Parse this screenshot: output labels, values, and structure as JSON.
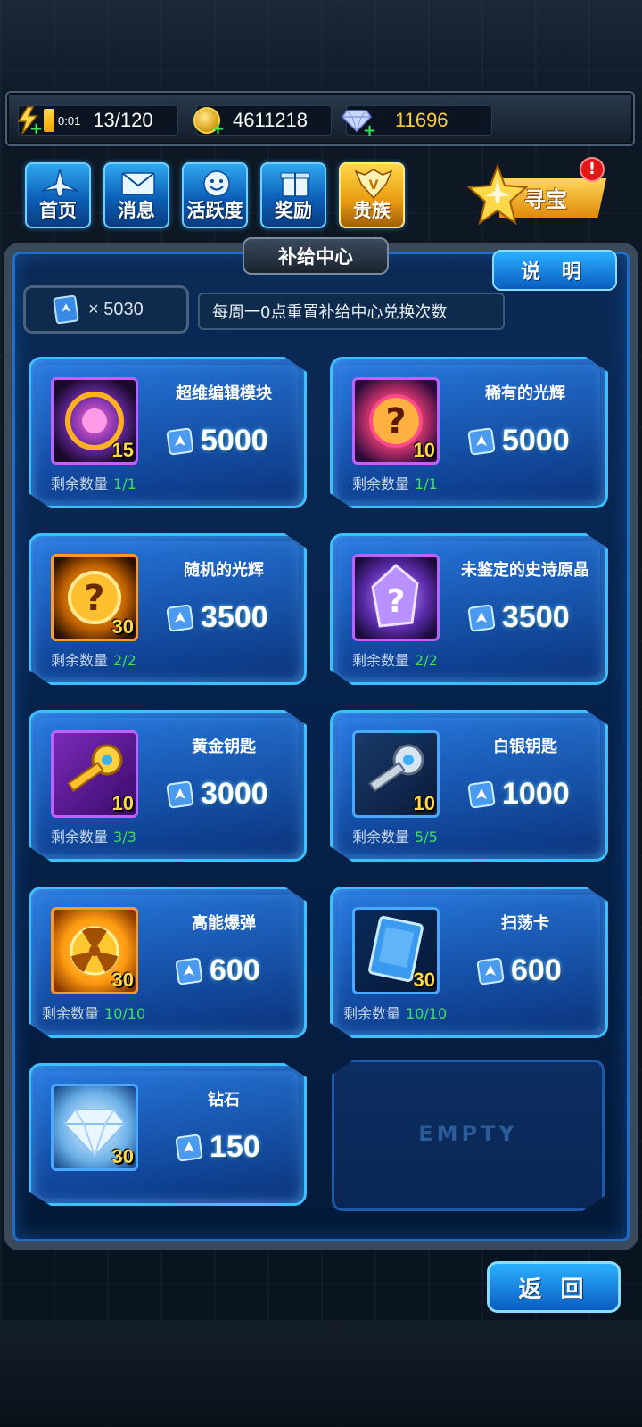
{
  "status": {
    "timer": "0:01",
    "energy": "13/120",
    "gold": "4611218",
    "gems": "11696"
  },
  "nav": [
    {
      "label": "首页"
    },
    {
      "label": "消息"
    },
    {
      "label": "活跃度"
    },
    {
      "label": "奖励"
    },
    {
      "label": "贵族"
    }
  ],
  "treasure": {
    "label": "寻宝",
    "badge": "!"
  },
  "panel": {
    "title": "补给中心",
    "explain": "说 明",
    "ticket_count": "× 5030",
    "info": "每周一0点重置补给中心兑换次数"
  },
  "items": [
    {
      "name": "超维编辑模块",
      "qty": "15",
      "price": "5000",
      "remain_label": "剩余数量",
      "remain": "1/1"
    },
    {
      "name": "稀有的光辉",
      "qty": "10",
      "price": "5000",
      "remain_label": "剩余数量",
      "remain": "1/1"
    },
    {
      "name": "随机的光辉",
      "qty": "30",
      "price": "3500",
      "remain_label": "剩余数量",
      "remain": "2/2"
    },
    {
      "name": "未鉴定的史诗原晶",
      "qty": "",
      "price": "3500",
      "remain_label": "剩余数量",
      "remain": "2/2"
    },
    {
      "name": "黄金钥匙",
      "qty": "10",
      "price": "3000",
      "remain_label": "剩余数量",
      "remain": "3/3"
    },
    {
      "name": "白银钥匙",
      "qty": "10",
      "price": "1000",
      "remain_label": "剩余数量",
      "remain": "5/5"
    },
    {
      "name": "高能爆弹",
      "qty": "30",
      "price": "600",
      "remain_label": "剩余数量",
      "remain": "10/10"
    },
    {
      "name": "扫荡卡",
      "qty": "30",
      "price": "600",
      "remain_label": "剩余数量",
      "remain": "10/10"
    },
    {
      "name": "钻石",
      "qty": "30",
      "price": "150",
      "remain_label": "",
      "remain": ""
    }
  ],
  "empty_label": "EMPTY",
  "back": "返 回",
  "colors": {
    "accent": "#3cc0ff",
    "remain_green": "#3de05a",
    "gem_gold": "#ffcf3a"
  }
}
